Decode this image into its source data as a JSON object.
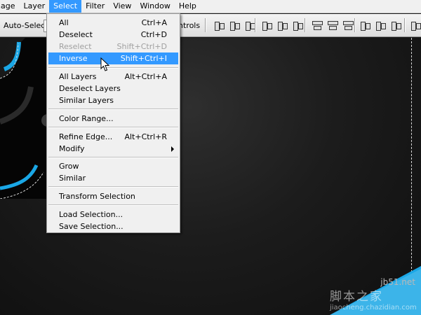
{
  "menubar": {
    "items": [
      "nage",
      "Layer",
      "Select",
      "Filter",
      "View",
      "Window",
      "Help"
    ],
    "active": "Select"
  },
  "options": {
    "auto_select_label": "Auto-Select:",
    "controls_label": "ntrols"
  },
  "select_menu": {
    "items": [
      {
        "label": "All",
        "shortcut": "Ctrl+A",
        "enabled": true
      },
      {
        "label": "Deselect",
        "shortcut": "Ctrl+D",
        "enabled": true
      },
      {
        "label": "Reselect",
        "shortcut": "Shift+Ctrl+D",
        "enabled": false
      },
      {
        "label": "Inverse",
        "shortcut": "Shift+Ctrl+I",
        "enabled": true,
        "highlighted": true
      },
      {
        "label": "All Layers",
        "shortcut": "Alt+Ctrl+A",
        "enabled": true
      },
      {
        "label": "Deselect Layers",
        "shortcut": "",
        "enabled": true
      },
      {
        "label": "Similar Layers",
        "shortcut": "",
        "enabled": true
      },
      {
        "label": "Color Range...",
        "shortcut": "",
        "enabled": true
      },
      {
        "label": "Refine Edge...",
        "shortcut": "Alt+Ctrl+R",
        "enabled": true
      },
      {
        "label": "Modify",
        "shortcut": "",
        "enabled": true,
        "submenu": true
      },
      {
        "label": "Grow",
        "shortcut": "",
        "enabled": true
      },
      {
        "label": "Similar",
        "shortcut": "",
        "enabled": true
      },
      {
        "label": "Transform Selection",
        "shortcut": "",
        "enabled": true
      },
      {
        "label": "Load Selection...",
        "shortcut": "",
        "enabled": true
      },
      {
        "label": "Save Selection...",
        "shortcut": "",
        "enabled": true
      }
    ]
  },
  "watermark": {
    "logo": "jb51.net",
    "cn_text": "脚本之家",
    "url": "jiaocheng.chazidian.com"
  },
  "colors": {
    "highlight": "#3399ff",
    "menu_bg": "#f0f0f0",
    "canvas_bg": "#1a1a1a",
    "accent_cyan": "#1aa7e6"
  },
  "icons": [
    "align-icon",
    "mouse-pointer-icon",
    "submenu-arrow-icon"
  ]
}
